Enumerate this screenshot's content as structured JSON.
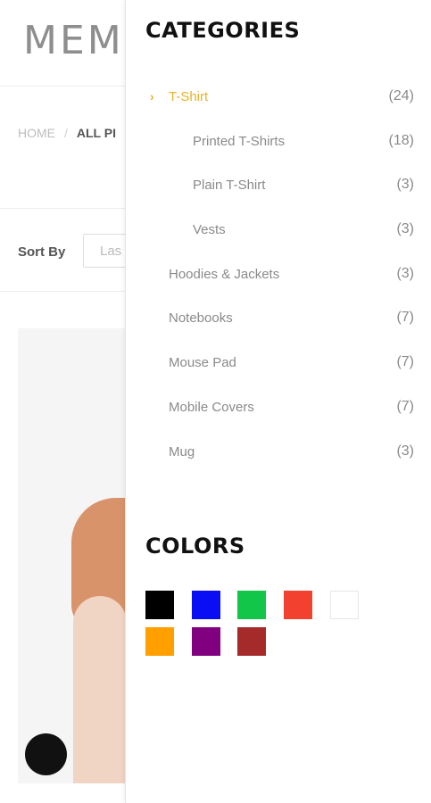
{
  "background_page": {
    "logo_text": "MEM",
    "breadcrumb": {
      "home": "HOME",
      "separator": "/",
      "current": "ALL PI"
    },
    "sort": {
      "label": "Sort By",
      "value": "Las"
    }
  },
  "drawer": {
    "categories_title": "CATEGORIES",
    "categories": [
      {
        "label": "T-Shirt",
        "count": "(24)",
        "active": true
      },
      {
        "label": "Printed T-Shirts",
        "count": "(18)"
      },
      {
        "label": "Plain T-Shirt",
        "count": "(3)"
      },
      {
        "label": "Vests",
        "count": "(3)"
      },
      {
        "label": "Hoodies & Jackets",
        "count": "(3)"
      },
      {
        "label": "Notebooks",
        "count": "(7)"
      },
      {
        "label": "Mouse Pad",
        "count": "(7)"
      },
      {
        "label": "Mobile Covers",
        "count": "(7)"
      },
      {
        "label": "Mug",
        "count": "(3)"
      }
    ],
    "active_icon": "chevron-right-icon",
    "colors_title": "COLORS",
    "colors": [
      "#000000",
      "#0a0ef5",
      "#12c64a",
      "#f2412e",
      "#ffffff",
      "#ff9f00",
      "#800080",
      "#a52a2a"
    ]
  }
}
